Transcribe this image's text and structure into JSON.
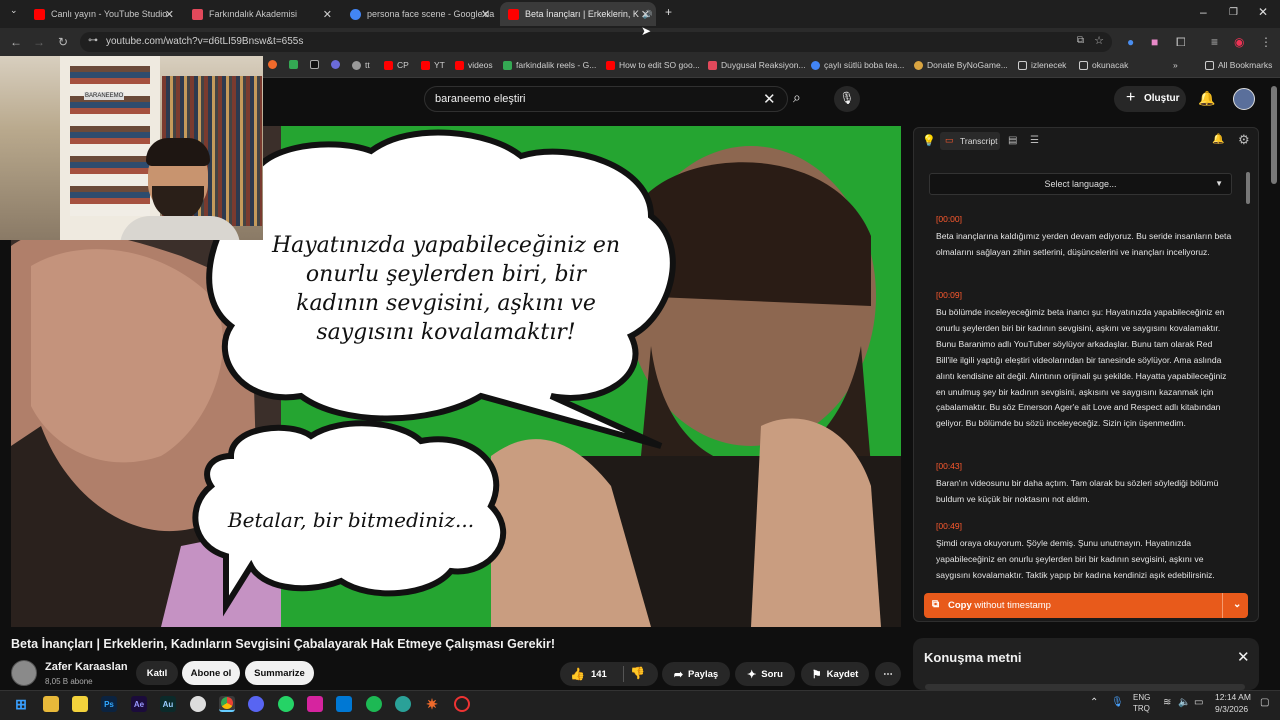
{
  "tabs": [
    {
      "title": "Canlı yayın - YouTube Studio",
      "color": "#ff0000"
    },
    {
      "title": "Farkındalık Akademisi",
      "color": "#e2495b"
    },
    {
      "title": "persona face scene - Google'da Ara",
      "color": "#4285f4"
    },
    {
      "title": "Beta İnançları | Erkeklerin, K",
      "color": "#ff0000"
    }
  ],
  "browser": {
    "url": "youtube.com/watch?v=d6tLI59Bnsw&t=655s"
  },
  "bookmarks": [
    "",
    "",
    "",
    "",
    "tt",
    "CP",
    "YT",
    "videos",
    "farkindalik reels - G...",
    "How to edit SO goo...",
    "Duygusal Reaksiyon...",
    "çaylı sütlü boba tea...",
    "Donate ByNoGame...",
    "izlenecek",
    "okunacak",
    "»",
    "All Bookmarks"
  ],
  "colors": {
    "accent": "#ff5a2e",
    "copy_button": "#e85a1b",
    "green_screen": "#25a531"
  },
  "youtube": {
    "search_value": "baraneemo eleştiri",
    "create_label": "Oluştur"
  },
  "video": {
    "bubble1": "Hayatınızda yapabileceğiniz en onurlu şeylerden biri, bir kadının sevgisini, aşkını ve saygısını kovalamaktır!",
    "bubble2": "Betalar, bir bitmediniz...",
    "webcam_book": "BARANEEMO"
  },
  "transcript": {
    "tab_label": "Transcript",
    "language_select": "Select language...",
    "segments": [
      {
        "time": "[00:00]",
        "text": "Beta inançlarına kaldığımız yerden devam ediyoruz. Bu seride insanların beta olmalarını sağlayan zihin setlerini, düşüncelerini ve inançları inceliyoruz."
      },
      {
        "time": "[00:09]",
        "text": "Bu bölümde inceleyeceğimiz beta inancı şu: Hayatınızda yapabileceğiniz en onurlu şeylerden biri bir kadının sevgisini, aşkını ve saygısını kovalamaktır. Bunu Baranimo adlı YouTuber söylüyor arkadaşlar. Bunu tam olarak Red Bill'ile ilgili yaptığı eleştiri videolarından bir tanesinde söylüyor. Ama aslında alıntı kendisine ait değil. Alıntının orijinali şu şekilde. Hayatta yapabileceğiniz en unulmuş şey bir kadının sevgisini, aşkısını ve saygısını kazanmak için çabalamaktır. Bu söz Emerson Ager'e ait Love and Respect adlı kitabından geliyor. Bu bölümde bu sözü inceleyeceğiz. Sizin için üşenmedim."
      },
      {
        "time": "[00:43]",
        "text": "Baran'ın videosunu bir daha açtım. Tam olarak bu sözleri söylediği bölümü buldum ve küçük bir noktasını not aldım."
      },
      {
        "time": "[00:49]",
        "text": "Şimdi oraya okuyorum. Şöyle demiş. Şunu unutmayın. Hayatınızda yapabileceğiniz en onurlu şeylerden biri bir kadının sevgisini, aşkını ve saygısını kovalamaktır. Taktik yapıp bir kadına kendinizi aşık edebilirsiniz."
      }
    ],
    "copy_label": "Copy",
    "copy_label_rest": "without timestamp",
    "konusma_title": "Konuşma metni"
  },
  "meta": {
    "title": "Beta İnançları | Erkeklerin, Kadınların Sevgisini Çabalayarak Hak Etmeye Çalışması Gerekir!",
    "channel": "Zafer Karaaslan",
    "subs": "8,05 B abone",
    "join": "Katıl",
    "subscribe": "Abone ol",
    "summarize": "Summarize",
    "likes": "141",
    "share": "Paylaş",
    "ask": "Soru",
    "save": "Kaydet"
  },
  "taskbar": {
    "apps": [
      "Ps",
      "Ae",
      "Au"
    ],
    "lang": "ENG",
    "lang2": "TRQ",
    "time": "12:14 AM",
    "date": "9/3/2026"
  }
}
